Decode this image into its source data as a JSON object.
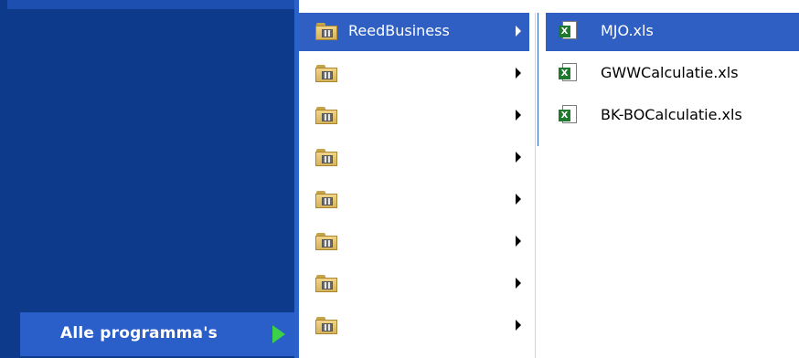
{
  "start_menu": {
    "all_programs_label": "Alle programma's"
  },
  "programs_submenu": {
    "items": [
      {
        "label": "ReedBusiness",
        "active": true
      },
      {
        "label": "",
        "active": false
      },
      {
        "label": "",
        "active": false
      },
      {
        "label": "",
        "active": false
      },
      {
        "label": "",
        "active": false
      },
      {
        "label": "",
        "active": false
      },
      {
        "label": "",
        "active": false
      },
      {
        "label": "",
        "active": false
      }
    ]
  },
  "files_submenu": {
    "items": [
      {
        "label": "MJO.xls",
        "active": true
      },
      {
        "label": "GWWCalculatie.xls",
        "active": false
      },
      {
        "label": "BK-BOCalculatie.xls",
        "active": false
      }
    ]
  },
  "icons": {
    "folder": "program-folder-icon",
    "excel": "excel-file-icon",
    "submenu_arrow": "submenu-arrow-icon",
    "all_programs_arrow": "green-arrow-icon"
  },
  "colors": {
    "start_panel": "#0e3a8c",
    "highlight": "#2f5fc2",
    "all_programs_arrow": "#3bd24a"
  }
}
